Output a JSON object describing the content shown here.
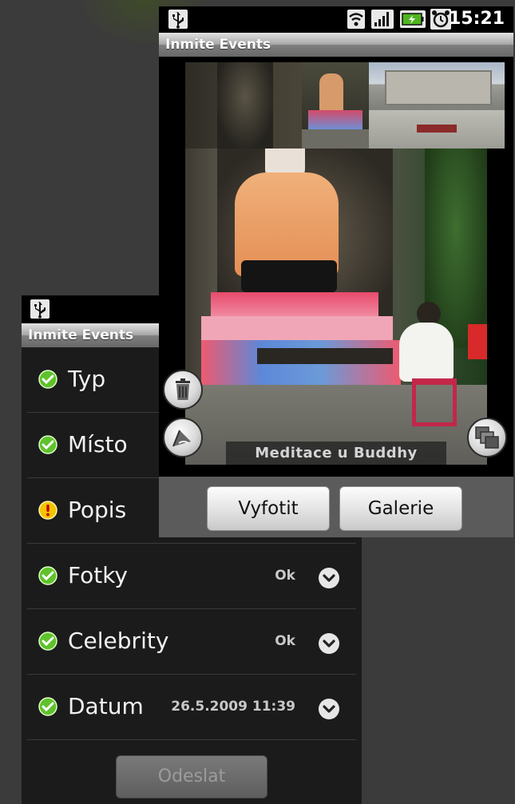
{
  "form_screen": {
    "title": "Inmite Events",
    "rows": [
      {
        "label": "Typ",
        "value": "",
        "status": "ok"
      },
      {
        "label": "Místo",
        "value": "",
        "status": "ok"
      },
      {
        "label": "Popis",
        "value": "",
        "status": "warning"
      },
      {
        "label": "Fotky",
        "value": "Ok",
        "status": "ok"
      },
      {
        "label": "Celebrity",
        "value": "Ok",
        "status": "ok"
      },
      {
        "label": "Datum",
        "value": "26.5.2009 11:39",
        "status": "ok"
      }
    ],
    "send_button": "Odeslat"
  },
  "photo_screen": {
    "title": "Inmite Events",
    "status_time": "15:21",
    "caption": "Meditace u Buddhy",
    "take_photo_button": "Vyfotit",
    "gallery_button": "Galerie"
  },
  "icons": {
    "status_ok": "check-circle-icon",
    "status_warning": "exclamation-circle-icon",
    "chevron": "chevron-down-icon",
    "delete": "trash-icon",
    "edit": "edit-icon",
    "switch": "stacked-photos-icon"
  },
  "colors": {
    "ok_green": "#5fc22c",
    "warning_yellow": "#f3c400",
    "title_bar": "#9a9a9a"
  }
}
